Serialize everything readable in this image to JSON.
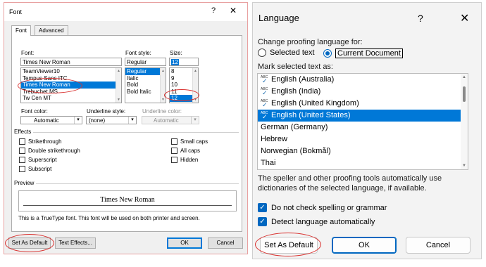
{
  "font_dialog": {
    "title": "Font",
    "help_glyph": "?",
    "close_glyph": "✕",
    "tabs": [
      {
        "label": "Font"
      },
      {
        "label": "Advanced"
      }
    ],
    "font_label": "Font:",
    "font_value": "Times New Roman",
    "font_list": [
      "TeamViewer10",
      "Tempus Sans ITC",
      "Times New Roman",
      "Trebuchet MS",
      "Tw Cen MT"
    ],
    "font_selected": "Times New Roman",
    "style_label": "Font style:",
    "style_value": "Regular",
    "style_list": [
      "Regular",
      "Italic",
      "Bold",
      "Bold Italic"
    ],
    "style_selected": "Regular",
    "size_label": "Size:",
    "size_value": "12",
    "size_list": [
      "8",
      "9",
      "10",
      "11",
      "12"
    ],
    "size_selected": "12",
    "font_color_label": "Font color:",
    "font_color_value": "Automatic",
    "underline_style_label": "Underline style:",
    "underline_style_value": "(none)",
    "underline_color_label": "Underline color:",
    "underline_color_value": "Automatic",
    "effects_label": "Effects",
    "effects_left": [
      "Strikethrough",
      "Double strikethrough",
      "Superscript",
      "Subscript"
    ],
    "effects_right": [
      "Small caps",
      "All caps",
      "Hidden"
    ],
    "preview_label": "Preview",
    "preview_text": "Times New Roman",
    "info_text": "This is a TrueType font. This font will be used on both printer and screen.",
    "buttons": {
      "set_default": "Set As Default",
      "text_effects": "Text Effects...",
      "ok": "OK",
      "cancel": "Cancel"
    }
  },
  "language_dialog": {
    "title": "Language",
    "help_glyph": "?",
    "close_glyph": "✕",
    "change_label": "Change proofing language for:",
    "radio_selected_text": "Selected text",
    "radio_current_document": "Current Document",
    "radio_checked": "Current Document",
    "mark_label": "Mark selected text as:",
    "languages": [
      {
        "name": "English (Australia)",
        "proofing": true
      },
      {
        "name": "English (India)",
        "proofing": true
      },
      {
        "name": "English (United Kingdom)",
        "proofing": true
      },
      {
        "name": "English (United States)",
        "proofing": true
      },
      {
        "name": "German (Germany)",
        "proofing": false
      },
      {
        "name": "Hebrew",
        "proofing": false
      },
      {
        "name": "Norwegian (Bokmål)",
        "proofing": false
      },
      {
        "name": "Thai",
        "proofing": false
      }
    ],
    "selected_language": "English (United States)",
    "description": "The speller and other proofing tools automatically use dictionaries of the selected language, if available.",
    "check_no_spelling": "Do not check spelling or grammar",
    "check_detect": "Detect language automatically",
    "check_no_spelling_checked": true,
    "check_detect_checked": true,
    "buttons": {
      "set_default": "Set As Default",
      "ok": "OK",
      "cancel": "Cancel"
    }
  },
  "colors": {
    "highlight": "#0078d7",
    "annotation_ring": "#d9312f",
    "accent": "#0067c0"
  }
}
